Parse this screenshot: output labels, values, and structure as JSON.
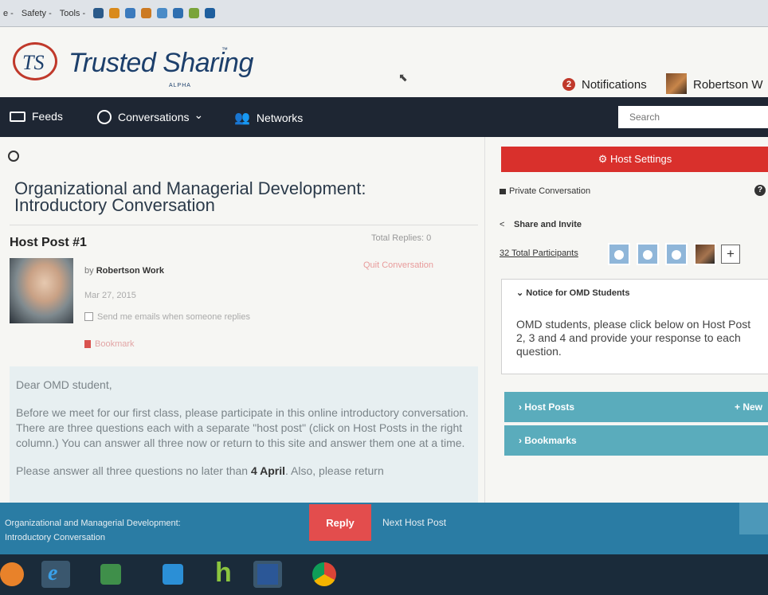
{
  "ie_toolbar": {
    "items": [
      "e -",
      "Safety -",
      "Tools -"
    ]
  },
  "header": {
    "logo_initials": "TS",
    "logo_name": "Trusted Sharing",
    "logo_tm": "™",
    "logo_sub": "ALPHA",
    "notifications_count": "2",
    "notifications_label": "Notifications",
    "user_name": "Robertson W"
  },
  "nav": {
    "feeds": "Feeds",
    "conversations": "Conversations",
    "conversations_caret": "⌄",
    "networks": "Networks",
    "search_placeholder": "Search"
  },
  "main": {
    "conversation_title": "Organizational and Managerial Development: Introductory Conversation",
    "post_title": "Host Post #1",
    "total_replies": "Total Replies: 0",
    "quit_conversation": "Quit Conversation",
    "by_prefix": "by",
    "author": "Robertson Work",
    "date": "Mar 27, 2015",
    "email_option": "Send me emails when someone replies",
    "bookmark": "Bookmark",
    "body": {
      "greeting": "Dear OMD student,",
      "para1": "Before we meet for our first class, please participate in this online introductory conversation. There are three questions each with a separate \"host post\" (click on Host Posts in the right column.) You can answer all three now or return to this site and answer them one at a time.",
      "para2_start": "Please answer all three questions no later than",
      "para2_bold": "4 April",
      "para2_end": ". Also, please return"
    }
  },
  "sidebar": {
    "host_settings": "Host Settings",
    "private_conversation": "Private Conversation",
    "help_icon_glyph": "?",
    "share_and_invite": "Share and Invite",
    "participants_link": "32 Total Participants",
    "add_participant": "+",
    "notice_heading": "Notice for OMD Students",
    "notice_text": "OMD students, please click below on Host Post 2, 3 and 4 and provide your response to each question.",
    "host_posts": "Host Posts",
    "new_label": "+ New",
    "bookmarks": "Bookmarks"
  },
  "bottom_bar": {
    "title_line1": "Organizational and Managerial Development:",
    "title_line2": "Introductory Conversation",
    "reply": "Reply",
    "next_host_post": "Next Host Post"
  },
  "taskbar": {
    "apps": [
      "windows-media-icon",
      "internet-explorer-icon",
      "excel-icon",
      "media-player-icon",
      "h-app-icon",
      "word-icon",
      "chrome-icon"
    ]
  },
  "colors": {
    "nav_bg": "#1e2633",
    "host_settings_bg": "#d9302c",
    "teal": "#5aacbc",
    "bottom_bar": "#2a7ca4",
    "reply": "#e34d4d",
    "logo_blue": "#1c3f6b"
  }
}
